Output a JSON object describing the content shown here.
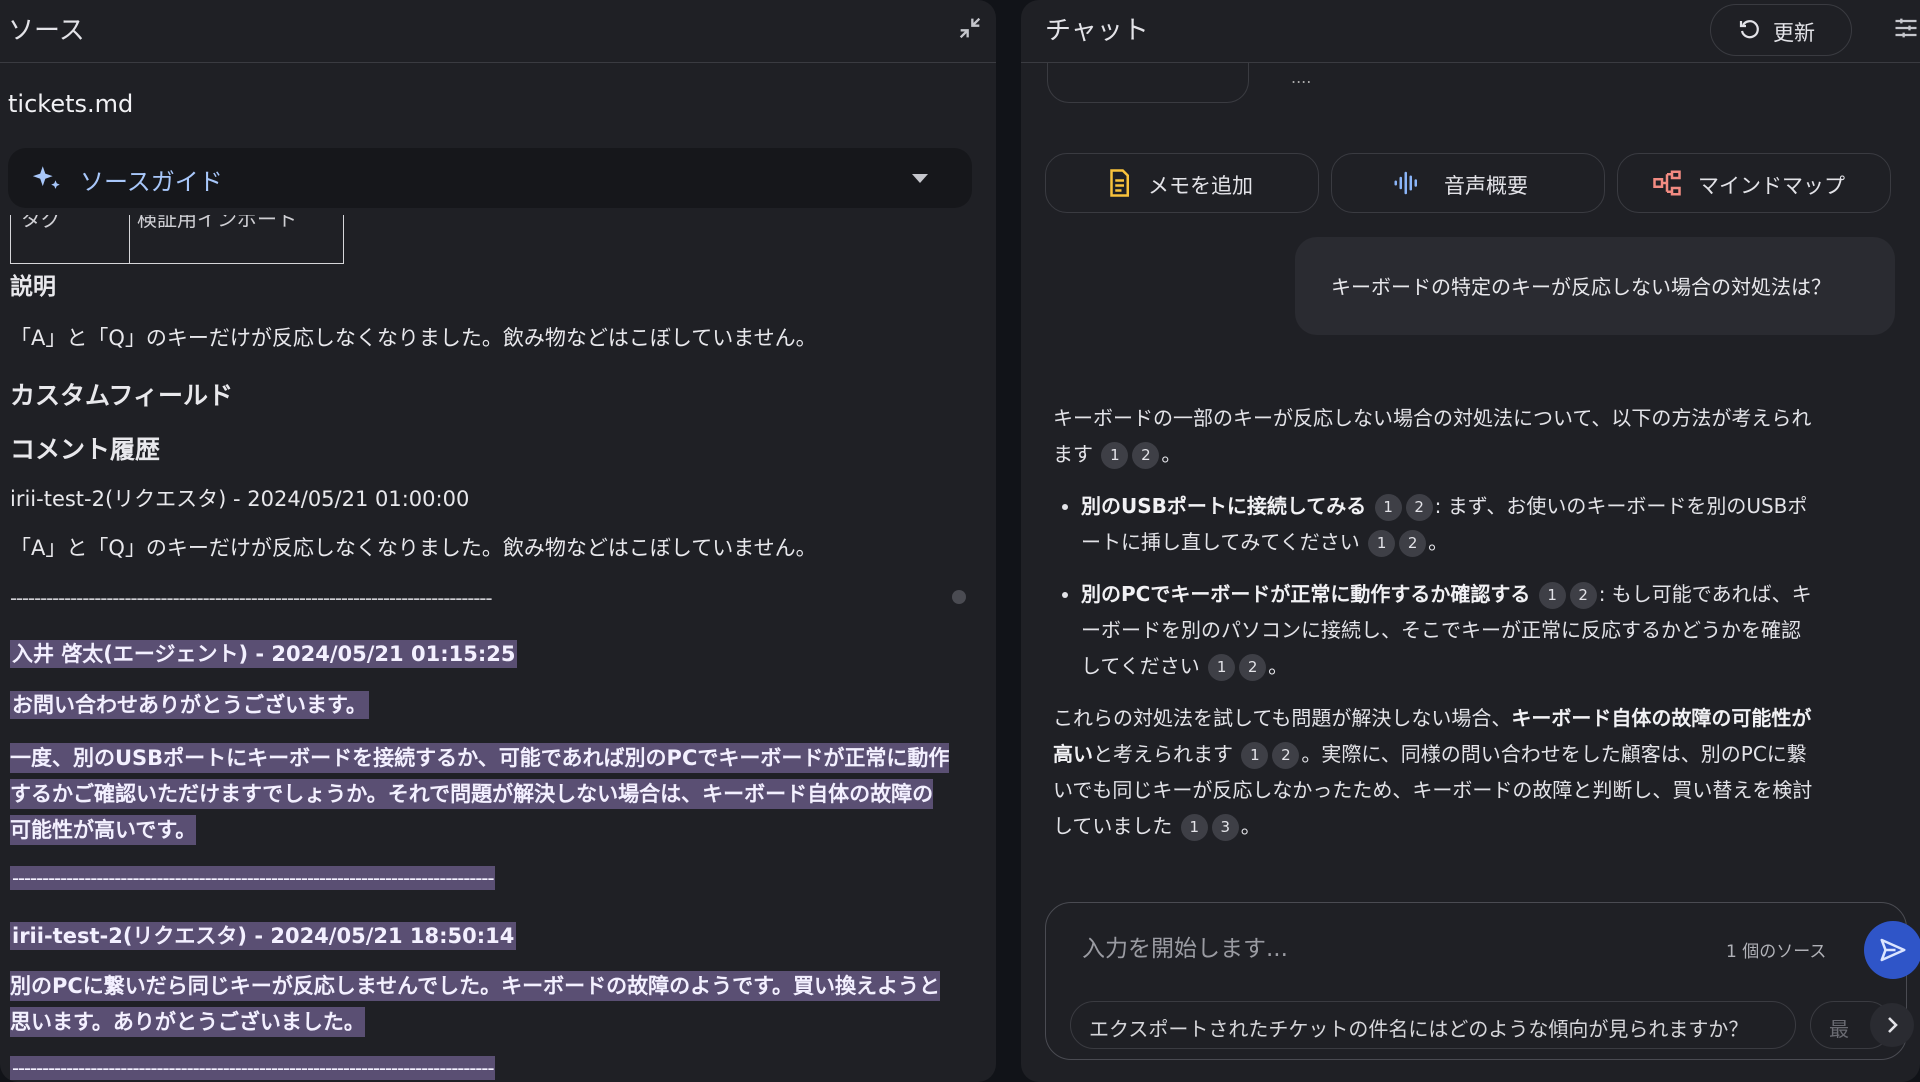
{
  "source_panel": {
    "title": "ソース",
    "file_name": "tickets.md",
    "guide_label": "ソースガイド",
    "table_fragment": {
      "cell1": "タグ",
      "cell2": "検証用インポート"
    },
    "heading_description": "説明",
    "description_text": "「A」と「Q」のキーだけが反応しなくなりました。飲み物などはこぼしていません。",
    "heading_custom_fields": "カスタムフィールド",
    "heading_comment_history": "コメント履歴",
    "comment1_author": "irii-test-2(リクエスタ) - 2024/05/21 01:00:00",
    "comment1_text": "「A」と「Q」のキーだけが反応しなくなりました。飲み物などはこぼしていません。",
    "separator": "--------------------------------------------------------------------------------",
    "comment2_author": "入井 啓太(エージェント) - 2024/05/21 01:15:25",
    "comment2_line1": "お問い合わせありがとうございます。",
    "comment2_line2": "一度、別のUSBポートにキーボードを接続するか、可能であれば別のPCでキーボードが正常に動作するかご確認いただけますでしょうか。それで問題が解決しない場合は、キーボード自体の故障の可能性が高いです。",
    "comment3_author": "irii-test-2(リクエスタ) - 2024/05/21 18:50:14",
    "comment3_text": "別のPCに繋いだら同じキーが反応しませんでした。キーボードの故障のようです。買い換えようと思います。ありがとうございました。"
  },
  "chat_panel": {
    "title": "チャット",
    "refresh_label": "更新",
    "ellipsis": "....",
    "actions": {
      "add_note": "メモを追加",
      "audio_overview": "音声概要",
      "mind_map": "マインドマップ"
    },
    "user_question": "キーボードの特定のキーが反応しない場合の対処法は？",
    "answer": {
      "intro": "キーボードの一部のキーが反応しない場合の対処法について、以下の方法が考えられます",
      "b1_title": "別のUSBポートに接続してみる",
      "b1_text": ": まず、お使いのキーボードを別のUSBポートに挿し直してみてください",
      "b2_title": "別のPCでキーボードが正常に動作するか確認する",
      "b2_text": ": もし可能であれば、キーボードを別のパソコンに接続し、そこでキーが正常に反応するかどうかを確認してください",
      "concl_pre": "これらの対処法を試しても問題が解決しない場合、",
      "concl_bold": "キーボード自体の故障の可能性が高い",
      "concl_mid": "と考えられます",
      "concl_post": "。実際に、同様の問い合わせをした顧客は、別のPCに繋いでも同じキーが反応しなかったため、キーボードの故障と判断し、買い替えを検討していました",
      "period": "。",
      "c1": "1",
      "c2": "2",
      "c3": "3"
    },
    "input_placeholder": "入力を開始します...",
    "source_count": "1 個のソース",
    "suggestion": "エクスポートされたチケットの件名にはどのような傾向が見られますか？",
    "suggestion2": "最"
  },
  "colors": {
    "accent": "#a8c7fa",
    "highlight": "#5a4f73",
    "send": "#2f55c8"
  }
}
